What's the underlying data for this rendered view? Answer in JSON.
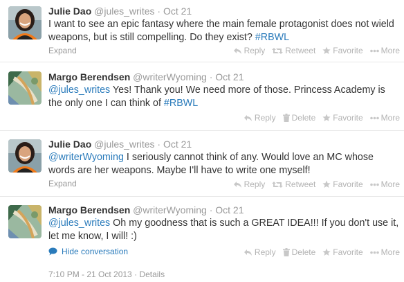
{
  "tweets": [
    {
      "fullname": "Julie Dao",
      "username": "@jules_writes",
      "time": "Oct 21",
      "text_parts": [
        "I want to see an epic fantasy where the main female protagonist does not wield weapons, but is still compelling. Do they exist? ",
        "#RBWL"
      ],
      "footer_link": "Expand",
      "actions": [
        "Reply",
        "Retweet",
        "Favorite",
        "More"
      ]
    },
    {
      "fullname": "Margo Berendsen",
      "username": "@writerWyoming",
      "time": "Oct 21",
      "text_parts": [
        "@jules_writes",
        "  Yes! Thank you!  We need more of those. Princess Academy is the only one I can think of ",
        "#RBWL"
      ],
      "actions": [
        "Reply",
        "Delete",
        "Favorite",
        "More"
      ]
    },
    {
      "fullname": "Julie Dao",
      "username": "@jules_writes",
      "time": "Oct 21",
      "text_parts": [
        "@writerWyoming",
        " I seriously cannot think of any. Would love an MC whose words are her weapons. Maybe I'll have to write one myself!"
      ],
      "footer_link": "Expand",
      "actions": [
        "Reply",
        "Retweet",
        "Favorite",
        "More"
      ]
    },
    {
      "fullname": "Margo Berendsen",
      "username": "@writerWyoming",
      "time": "Oct 21",
      "text_parts": [
        "@jules_writes",
        "  Oh my goodness that is such a GREAT IDEA!!! If you don't use it, let me know, I will! :)"
      ],
      "footer_link": "Hide conversation",
      "actions": [
        "Reply",
        "Delete",
        "Favorite",
        "More"
      ],
      "timestamp": "7:10 PM - 21 Oct 2013",
      "details": "Details"
    }
  ],
  "separator": "·",
  "colors": {
    "link": "#2a7bbb",
    "muted": "#999999",
    "text": "#333333",
    "divider": "#e8e8e8"
  }
}
